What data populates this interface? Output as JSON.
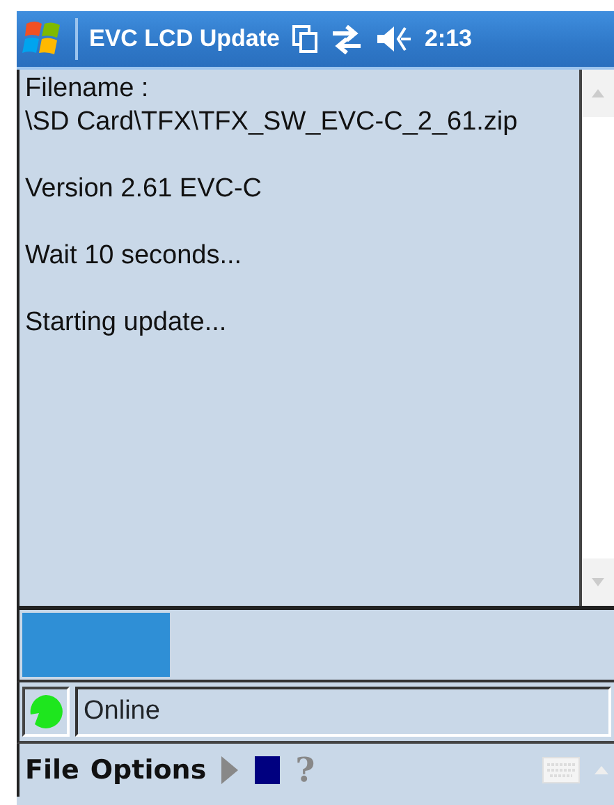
{
  "title_bar": {
    "title": "EVC LCD Update",
    "time": "2:13"
  },
  "log": [
    [
      "Filename :",
      "\\SD Card\\TFX\\TFX_SW_EVC-C_2_61.zip"
    ],
    [
      "Version 2.61 EVC-C"
    ],
    [
      "Wait 10 seconds..."
    ],
    [
      "Starting update..."
    ]
  ],
  "progress": {
    "level": 0.25
  },
  "status": {
    "text": "Online"
  },
  "menu_bar": {
    "items": [
      "File",
      "Options"
    ],
    "help": "?"
  }
}
